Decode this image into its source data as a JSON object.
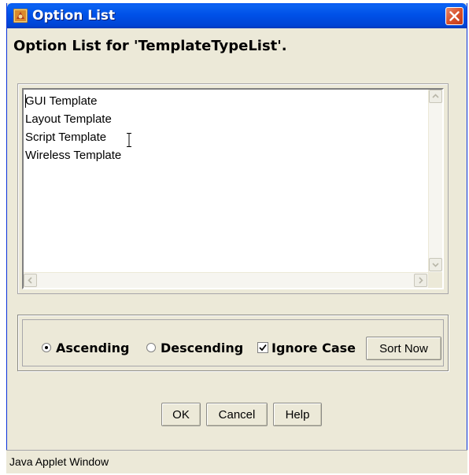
{
  "window": {
    "title": "Option List"
  },
  "heading": "Option List for 'TemplateTypeList'.",
  "options_list": {
    "items": [
      "GUI Template",
      "Layout Template",
      "Script Template",
      "Wireless Template"
    ]
  },
  "sort": {
    "ascending_label": "Ascending",
    "descending_label": "Descending",
    "ignore_case_label": "Ignore Case",
    "ascending_selected": true,
    "ignore_case_checked": true,
    "sort_now_label": "Sort Now"
  },
  "buttons": {
    "ok_label": "OK",
    "cancel_label": "Cancel",
    "help_label": "Help"
  },
  "status": {
    "text": "Java Applet Window"
  },
  "colors": {
    "titlebar": "#0054e3",
    "dialog_bg": "#ece9d8",
    "close_button": "#d9522c"
  }
}
